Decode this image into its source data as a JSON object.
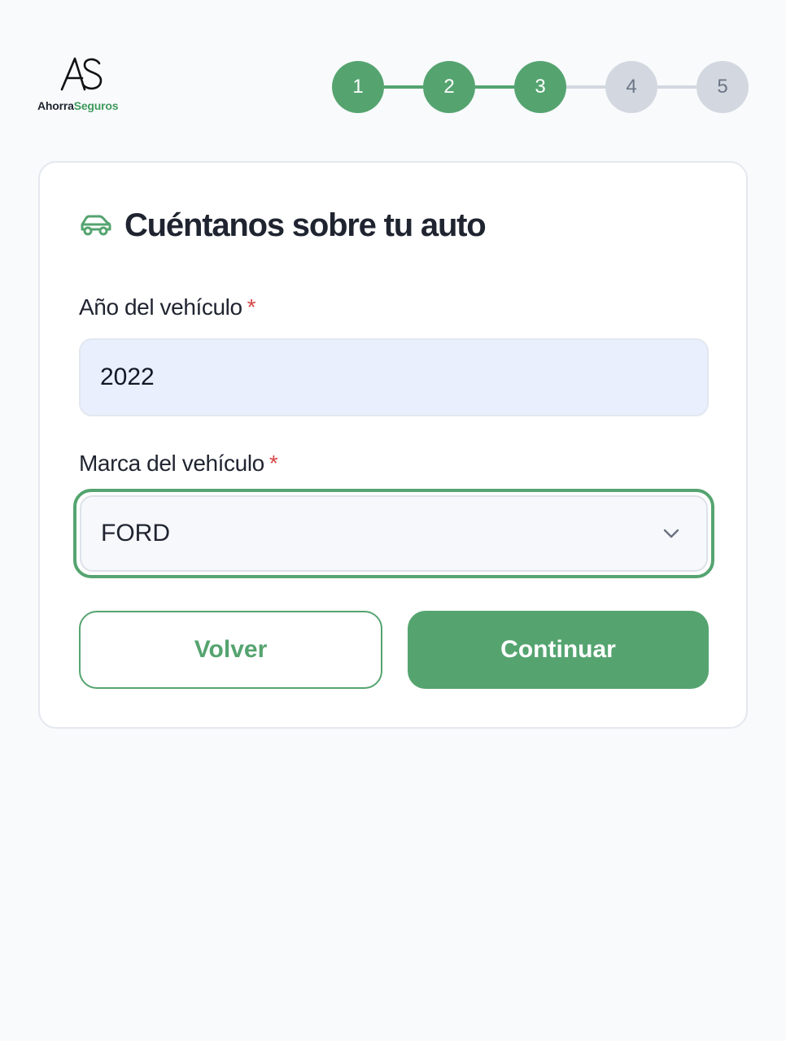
{
  "brand": {
    "logo_mark": "AS",
    "name_part1": "Ahorra",
    "name_part2": "Seguros",
    "accent_color": "#55a470"
  },
  "stepper": {
    "current_step": 3,
    "steps": [
      {
        "label": "1",
        "state": "done"
      },
      {
        "label": "2",
        "state": "done"
      },
      {
        "label": "3",
        "state": "done"
      },
      {
        "label": "4",
        "state": "todo"
      },
      {
        "label": "5",
        "state": "todo"
      }
    ]
  },
  "card": {
    "icon": "car-icon",
    "title": "Cuéntanos sobre tu auto"
  },
  "form": {
    "year": {
      "label": "Año del vehículo",
      "required_mark": "*",
      "value": "2022"
    },
    "brand": {
      "label": "Marca del vehículo",
      "required_mark": "*",
      "selected": "FORD",
      "icon": "chevron-down-icon"
    }
  },
  "actions": {
    "back_label": "Volver",
    "continue_label": "Continuar"
  }
}
